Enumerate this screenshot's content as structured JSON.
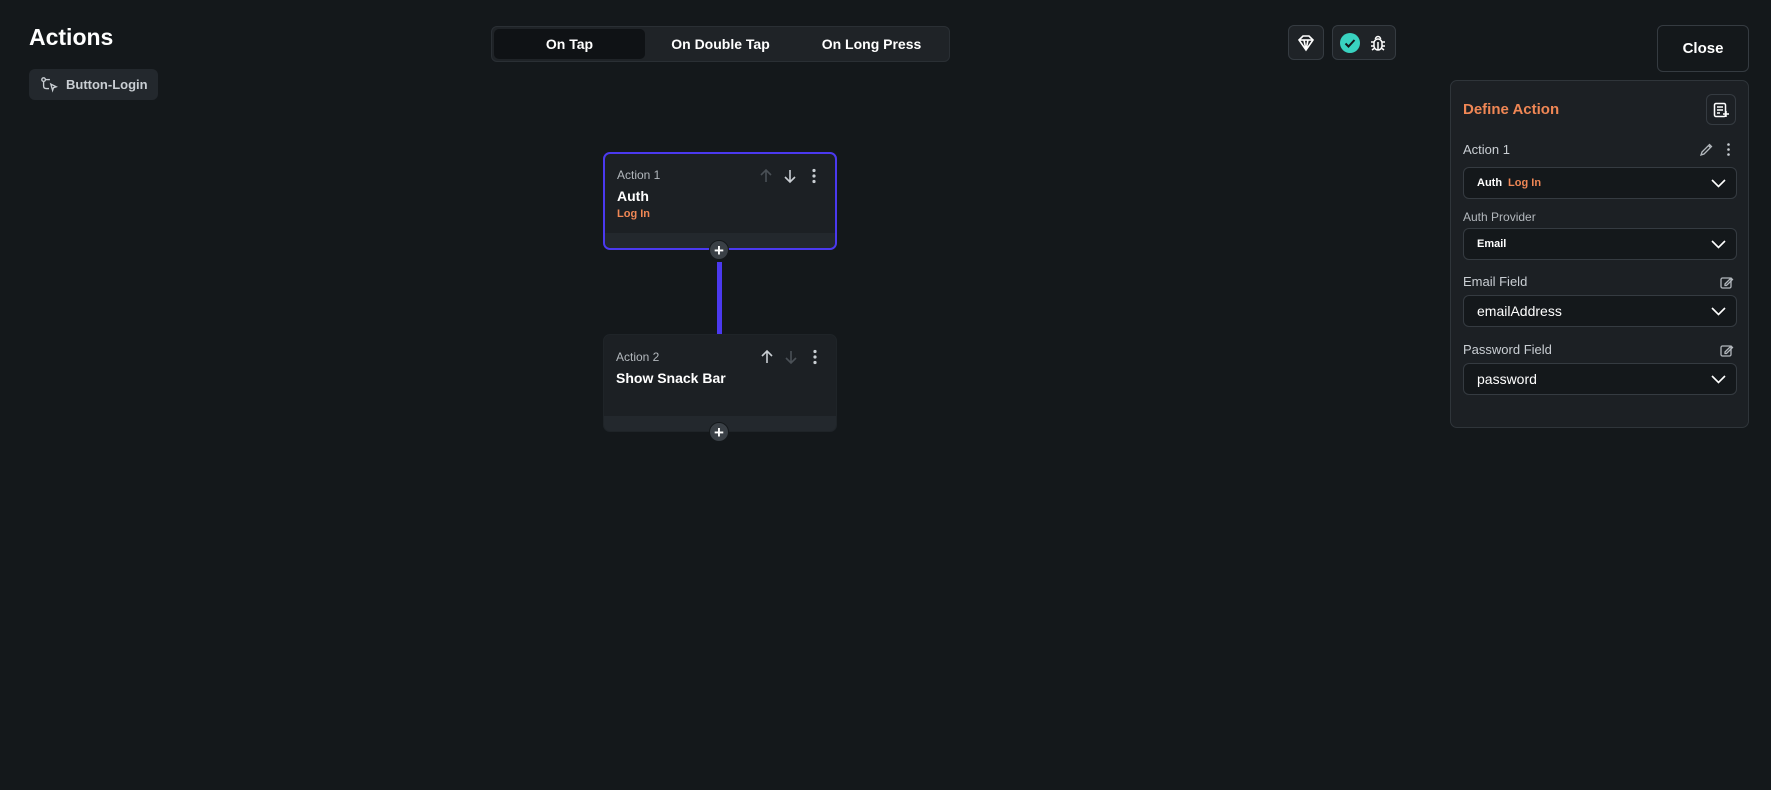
{
  "header": {
    "title": "Actions",
    "widget_name": "Button-Login",
    "close_label": "Close"
  },
  "triggers": [
    {
      "label": "On Tap",
      "active": true
    },
    {
      "label": "On Double Tap",
      "active": false
    },
    {
      "label": "On Long Press",
      "active": false
    }
  ],
  "toolbar_icons": [
    "ai-gem-icon",
    "check-circle-icon",
    "bug-icon"
  ],
  "canvas": {
    "actions": [
      {
        "number": "Action 1",
        "name": "Auth",
        "subtitle": "Log In"
      },
      {
        "number": "Action 2",
        "name": "Show Snack Bar",
        "subtitle": ""
      }
    ],
    "add_symbol": "+"
  },
  "panel": {
    "title": "Define Action",
    "action_label": "Action 1",
    "action_type": "Auth",
    "action_subtype": "Log In",
    "auth_provider_label": "Auth Provider",
    "auth_provider_value": "Email",
    "email_field_label": "Email Field",
    "email_field_value": "emailAddress",
    "password_field_label": "Password Field",
    "password_field_value": "password"
  },
  "colors": {
    "accent": "#4b39ef",
    "orange": "#f08755",
    "success": "#39d2c0",
    "background": "#14181b"
  }
}
